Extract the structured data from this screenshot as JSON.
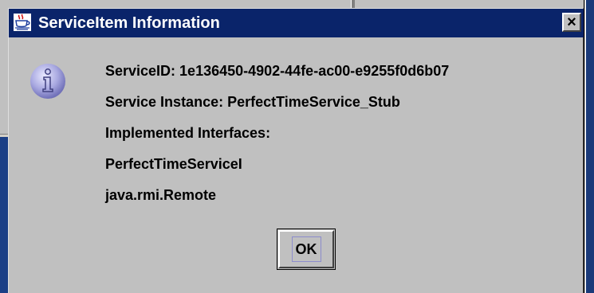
{
  "dialog": {
    "title": "ServiceItem Information",
    "title_icon": "java-cup-icon",
    "close_label": "×",
    "message_icon": "info-icon",
    "lines": [
      "ServiceID: 1e136450-4902-44fe-ac00-e9255f0d6b07",
      "Service Instance: PerfectTimeService_Stub",
      "Implemented Interfaces:",
      "PerfectTimeServiceI",
      "java.rmi.Remote"
    ],
    "ok_label": "OK"
  },
  "colors": {
    "titlebar": "#0a246a",
    "window_bg": "#c0c0c0",
    "background_navy": "#1b3f86"
  }
}
